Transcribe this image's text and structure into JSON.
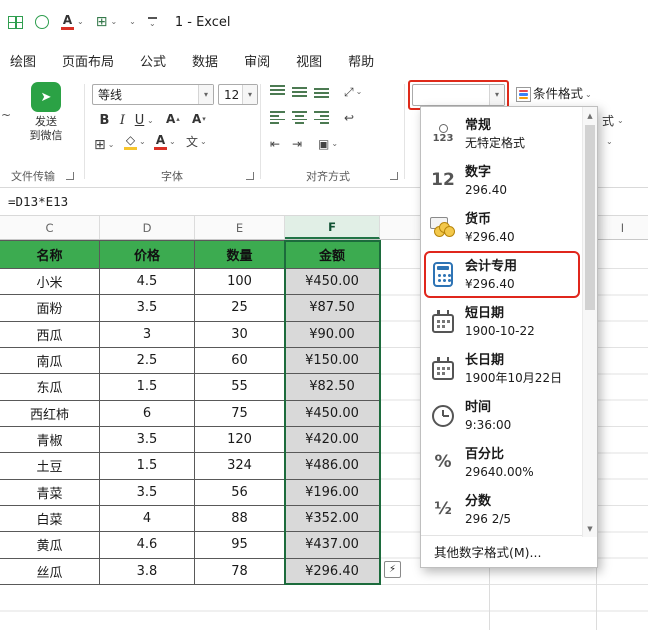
{
  "titlebar": {
    "title": "1 - Excel"
  },
  "menubar": {
    "tabs": [
      "绘图",
      "页面布局",
      "公式",
      "数据",
      "审阅",
      "视图",
      "帮助"
    ]
  },
  "ribbon": {
    "send_line1": "发送",
    "send_line2": "到微信",
    "group_file_transfer": "文件传输",
    "font_name": "等线",
    "font_size": "12",
    "group_font": "字体",
    "group_alignment": "对齐方式",
    "number_format_value": "",
    "conditional_format_label": "条件格式",
    "fragment_style": "式"
  },
  "formula_bar": {
    "formula": "=D13*E13"
  },
  "sheet": {
    "column_headers": [
      "C",
      "D",
      "E",
      "F",
      "I"
    ],
    "table_columns": [
      "名称",
      "价格",
      "数量",
      "金额"
    ],
    "rows": [
      {
        "name": "小米",
        "price": "4.5",
        "qty": "100",
        "amount": "¥450.00"
      },
      {
        "name": "面粉",
        "price": "3.5",
        "qty": "25",
        "amount": "¥87.50"
      },
      {
        "name": "西瓜",
        "price": "3",
        "qty": "30",
        "amount": "¥90.00"
      },
      {
        "name": "南瓜",
        "price": "2.5",
        "qty": "60",
        "amount": "¥150.00"
      },
      {
        "name": "东瓜",
        "price": "1.5",
        "qty": "55",
        "amount": "¥82.50"
      },
      {
        "name": "西红柿",
        "price": "6",
        "qty": "75",
        "amount": "¥450.00"
      },
      {
        "name": "青椒",
        "price": "3.5",
        "qty": "120",
        "amount": "¥420.00"
      },
      {
        "name": "土豆",
        "price": "1.5",
        "qty": "324",
        "amount": "¥486.00"
      },
      {
        "name": "青菜",
        "price": "3.5",
        "qty": "56",
        "amount": "¥196.00"
      },
      {
        "name": "白菜",
        "price": "4",
        "qty": "88",
        "amount": "¥352.00"
      },
      {
        "name": "黄瓜",
        "price": "4.6",
        "qty": "95",
        "amount": "¥437.00"
      },
      {
        "name": "丝瓜",
        "price": "3.8",
        "qty": "78",
        "amount": "¥296.40"
      }
    ]
  },
  "format_dropdown": {
    "items": [
      {
        "icon": "general-format-icon",
        "title": "常规",
        "example": "无特定格式"
      },
      {
        "icon": "number-format-icon",
        "title": "数字",
        "example": "296.40"
      },
      {
        "icon": "currency-format-icon",
        "title": "货币",
        "example": "¥296.40"
      },
      {
        "icon": "accounting-format-icon",
        "title": "会计专用",
        "example": "¥296.40"
      },
      {
        "icon": "short-date-format-icon",
        "title": "短日期",
        "example": "1900-10-22"
      },
      {
        "icon": "long-date-format-icon",
        "title": "长日期",
        "example": "1900年10月22日"
      },
      {
        "icon": "time-format-icon",
        "title": "时间",
        "example": "9:36:00"
      },
      {
        "icon": "percentage-format-icon",
        "title": "百分比",
        "example": "29640.00%"
      },
      {
        "icon": "fraction-format-icon",
        "title": "分数",
        "example": "296 2/5"
      }
    ],
    "footer": "其他数字格式(M)..."
  },
  "icons": {
    "letter_a": "A",
    "bold": "B",
    "italic": "I",
    "underline": "U",
    "chevron_down": "▾",
    "chevron_small": "⌄",
    "scroll_up": "▲",
    "scroll_down": "▼",
    "lightning": "⚡",
    "borders_glyph": "⊞",
    "fill_glyph": "◇",
    "phonetic": "文",
    "orientation": "⤢",
    "wrap": "↩",
    "merge": "▣",
    "indent_left": "⇤",
    "indent_right": "⇥",
    "number_12": "12",
    "percent": "%",
    "fraction": "½",
    "g123": "123",
    "send_plane": "➤",
    "tilde_fragment": "~"
  },
  "colors": {
    "accent_green": "#217346",
    "header_green": "#3CAB50",
    "highlight_red": "#E0261C",
    "selection_gray": "#D9D9D9"
  }
}
